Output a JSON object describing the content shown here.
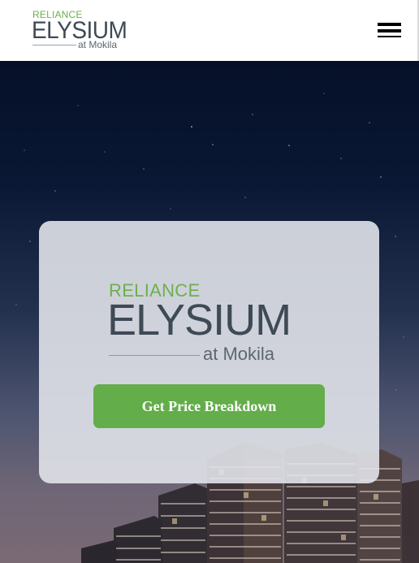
{
  "header": {
    "logo": {
      "brand_top": "RELIANCE",
      "brand_main": "ELYSIUM",
      "brand_sub": "at Mokila"
    },
    "menu_icon": "hamburger-menu-icon"
  },
  "hero": {
    "background": "night-sky-with-apartment-towers",
    "card": {
      "logo": {
        "brand_top": "RELIANCE",
        "brand_main": "ELYSIUM",
        "brand_sub": "at Mokila"
      },
      "cta_label": "Get Price Breakdown"
    }
  },
  "colors": {
    "brand_green": "#6bb14d",
    "brand_slate": "#3e4a56",
    "button_green": "#63ad4a",
    "sky_dark": "#051028"
  }
}
